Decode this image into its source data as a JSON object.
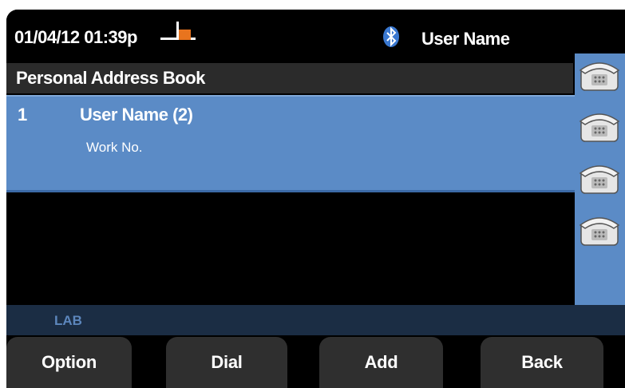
{
  "status_bar": {
    "datetime": "01/04/12 01:39p",
    "line_icon": "line-status-icon",
    "bluetooth_icon": "bluetooth-icon",
    "user_name": "User Name"
  },
  "title_bar": {
    "title": "Personal Address Book"
  },
  "list": {
    "items": [
      {
        "index": "1",
        "name": "User Name (2)",
        "subtitle": "Work No."
      }
    ]
  },
  "side_keys": [
    {
      "icon": "phone-icon"
    },
    {
      "icon": "phone-icon"
    },
    {
      "icon": "phone-icon"
    },
    {
      "icon": "phone-icon"
    }
  ],
  "label_bar": {
    "text": "LAB"
  },
  "softkeys": [
    {
      "label": "Option"
    },
    {
      "label": "Dial"
    },
    {
      "label": "Add"
    },
    {
      "label": "Back"
    }
  ],
  "colors": {
    "highlight": "#5b8bc6",
    "label_bar": "#1b2d44",
    "line_icon_accent": "#e8741e"
  }
}
